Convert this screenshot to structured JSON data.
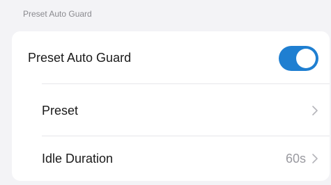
{
  "section": {
    "title": "Preset Auto Guard"
  },
  "auto_guard": {
    "label": "Preset Auto Guard",
    "enabled": true,
    "toggle_color": "#1f7fd1"
  },
  "preset": {
    "label": "Preset",
    "icon": "chevron-right-icon"
  },
  "idle_duration": {
    "label": "Idle Duration",
    "value": "60s",
    "icon": "chevron-right-icon"
  }
}
